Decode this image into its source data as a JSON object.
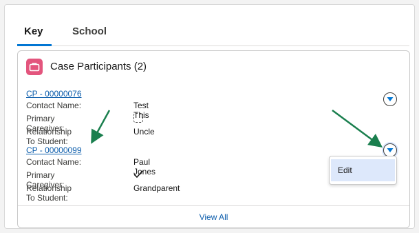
{
  "tabs": [
    {
      "label": "Key",
      "active": true
    },
    {
      "label": "School",
      "active": false
    }
  ],
  "card": {
    "icon": "briefcase-icon",
    "icon_color": "#e3557d",
    "title": "Case Participants (2)"
  },
  "records": [
    {
      "id": "CP - 00000076",
      "fields": [
        {
          "label": "Contact Name:",
          "value": "Test This"
        },
        {
          "label": "Primary Caregiver:",
          "checked": false
        },
        {
          "label": "Relationship To Student:",
          "value": "Uncle"
        }
      ]
    },
    {
      "id": "CP - 00000099",
      "fields": [
        {
          "label": "Contact Name:",
          "value": "Paul Jones"
        },
        {
          "label": "Primary Caregiver:",
          "checked": true
        },
        {
          "label": "Relationship To Student:",
          "value": "Grandparent"
        }
      ]
    }
  ],
  "row_menu": {
    "open_on_record": 2,
    "items": [
      "Edit"
    ]
  },
  "footer": {
    "view_all": "View All"
  },
  "colors": {
    "link": "#0b5cab",
    "accent": "#0176d3",
    "annotation_arrow": "#1a7f4e",
    "menu_highlight": "#dde8fb"
  }
}
